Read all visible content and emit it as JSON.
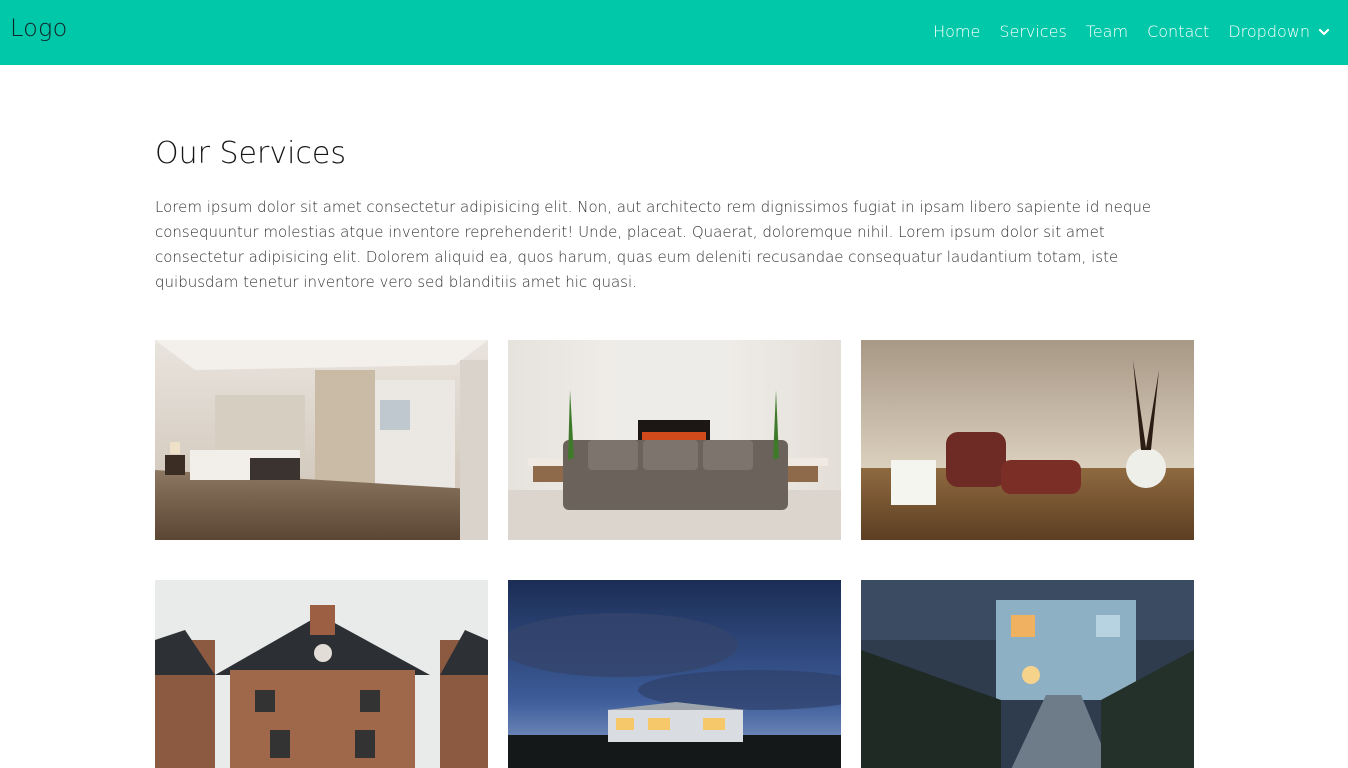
{
  "navbar": {
    "logo": "Logo",
    "links": [
      "Home",
      "Services",
      "Team",
      "Contact"
    ],
    "dropdown_label": "Dropdown",
    "dropdown_icon": "chevron-down-icon",
    "background": "#00c8a8"
  },
  "main": {
    "title": "Our Services",
    "description": "Lorem ipsum dolor sit amet consectetur adipisicing elit. Non, aut architecto rem dignissimos fugiat in ipsam libero sapiente id neque consequuntur molestias atque inventore reprehenderit! Unde, placeat. Quaerat, doloremque nihil. Lorem ipsum dolor sit amet consectetur adipisicing elit. Dolorem aliquid ea, quos harum, quas eum deleniti recusandae consequatur laudantium totam, iste quibusdam tenetur inventore vero sed blanditiis amet hic quasi."
  }
}
